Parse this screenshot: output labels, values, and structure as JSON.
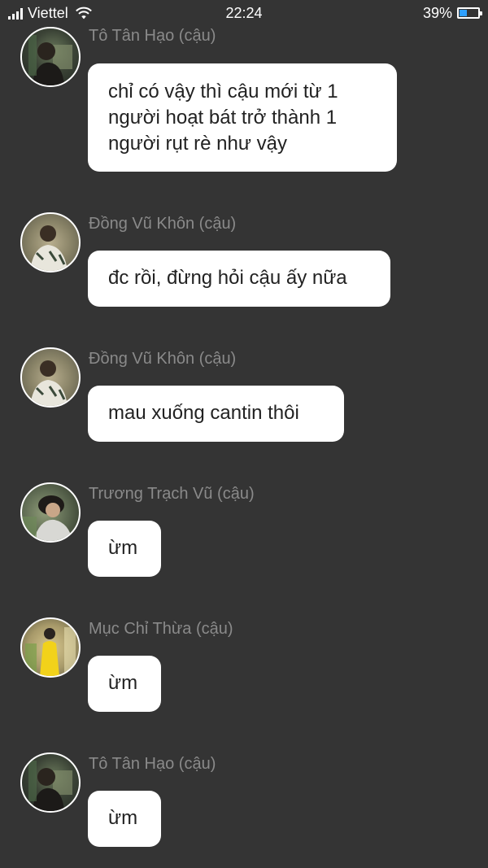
{
  "status_bar": {
    "carrier": "Viettel",
    "time": "22:24",
    "battery_percent": "39%",
    "battery_level": 0.39
  },
  "messages": [
    {
      "sender": "Tô Tân Hạo (cậu)",
      "avatar": "photo-avatar",
      "lines": [
        "chỉ có vậy thì cậu mới từ 1",
        "người hoạt bát trở thành 1",
        "người rụt rè như vậy"
      ]
    },
    {
      "sender": "Đồng Vũ Khôn (cậu)",
      "avatar": "photo-avatar",
      "lines": [
        "đc rồi, đừng hỏi cậu ấy nữa"
      ]
    },
    {
      "sender": "Đồng Vũ Khôn (cậu)",
      "avatar": "photo-avatar",
      "lines": [
        "mau xuống cantin thôi"
      ]
    },
    {
      "sender": "Trương Trạch Vũ (cậu)",
      "avatar": "photo-avatar",
      "lines": [
        "ừm"
      ]
    },
    {
      "sender": "Mục Chỉ Thừa (cậu)",
      "avatar": "photo-avatar",
      "lines": [
        "ừm"
      ]
    },
    {
      "sender": "Tô Tân Hạo (cậu)",
      "avatar": "photo-avatar",
      "lines": [
        "ừm"
      ]
    }
  ]
}
